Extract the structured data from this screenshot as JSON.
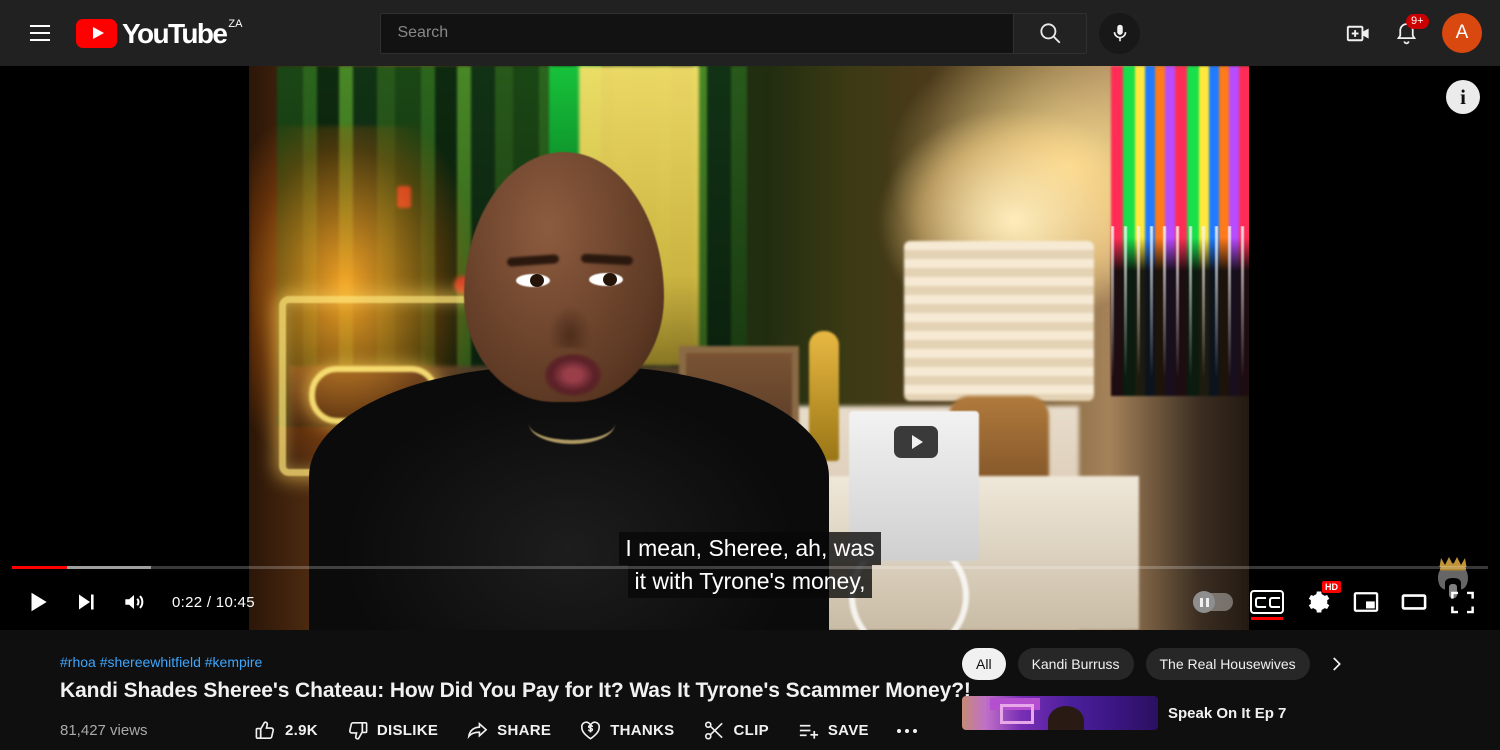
{
  "masthead": {
    "guide_icon": "hamburger-menu-icon",
    "logo_text": "YouTube",
    "logo_country_code": "ZA",
    "search": {
      "placeholder": "Search",
      "icon": "search-icon"
    },
    "mic_icon": "microphone-icon",
    "create_icon": "create-video-icon",
    "notifications_icon": "bell-icon",
    "notifications_count": "9+",
    "avatar_initial": "A",
    "avatar_color": "#d9480f"
  },
  "player": {
    "info_icon": "info-icon",
    "watermark": "crowned-elephant-logo",
    "captions": [
      "I mean, Sheree, ah, was",
      "it with Tyrone's money,"
    ],
    "progress": {
      "played_percent": 3.7,
      "buffered_percent": 9.4,
      "played_color": "#ff0000"
    },
    "controls": {
      "play_icon": "play-icon",
      "next_icon": "next-video-icon",
      "volume_icon": "volume-icon",
      "time_current": "0:22",
      "time_separator": "/",
      "time_total": "10:45",
      "time_display": "0:22 / 10:45",
      "autoplay_icon": "autoplay-toggle",
      "autoplay_state": "on",
      "subtitles_icon": "closed-captions-icon",
      "subtitles_state": "on",
      "settings_icon": "gear-icon",
      "quality_badge": "HD",
      "miniplayer_icon": "miniplayer-icon",
      "theater_icon": "theater-mode-icon",
      "fullscreen_icon": "fullscreen-icon"
    }
  },
  "video_info": {
    "hashtags": "#rhoa #shereewhitfield #kempire",
    "title": "Kandi Shades Sheree's Chateau: How Did You Pay for It? Was It Tyrone's Scammer Money?!",
    "views": "81,427 views",
    "actions": [
      {
        "name": "like",
        "label": "2.9K",
        "icon": "thumbs-up-icon"
      },
      {
        "name": "dislike",
        "label": "DISLIKE",
        "icon": "thumbs-down-icon"
      },
      {
        "name": "share",
        "label": "SHARE",
        "icon": "share-arrow-icon"
      },
      {
        "name": "thanks",
        "label": "THANKS",
        "icon": "heart-dollar-icon"
      },
      {
        "name": "clip",
        "label": "CLIP",
        "icon": "scissors-icon"
      },
      {
        "name": "save",
        "label": "SAVE",
        "icon": "save-list-icon"
      }
    ],
    "more_icon": "more-horizontal-icon"
  },
  "sidebar": {
    "chips": [
      {
        "label": "All",
        "active": true
      },
      {
        "label": "Kandi Burruss",
        "active": false
      },
      {
        "label": "The Real Housewives",
        "active": false
      }
    ],
    "chip_next_icon": "chevron-right-icon",
    "recommendations": [
      {
        "title": "Speak On It Ep 7"
      }
    ]
  }
}
